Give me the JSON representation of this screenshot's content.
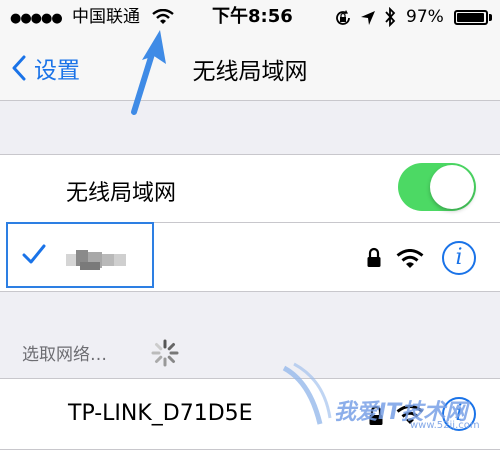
{
  "status_bar": {
    "signal": "●●●●●",
    "carrier": "中国联通",
    "time": "下午8:56",
    "battery": "97%",
    "icons": [
      "wifi-icon",
      "rotation-lock-icon",
      "location-icon",
      "bluetooth-icon",
      "battery-icon"
    ]
  },
  "nav": {
    "back_label": "设置",
    "title": "无线局域网"
  },
  "wifi_toggle": {
    "label": "无线局域网",
    "state": "on",
    "color": "#4cd964"
  },
  "connected_network": {
    "selected": true,
    "icons": [
      "checkmark-icon",
      "lock-icon",
      "wifi-icon",
      "info-icon"
    ]
  },
  "choose_network": {
    "header": "选取网络…"
  },
  "networks": [
    {
      "name": "TP-LINK_D71D5E",
      "secured": true
    }
  ],
  "colors": {
    "accent": "#1a73e8",
    "toggle_on": "#4cd964",
    "annotation": "#2d7fe3"
  },
  "watermark": {
    "text": "我爱IT技术网",
    "url": "www.52ij.com"
  }
}
